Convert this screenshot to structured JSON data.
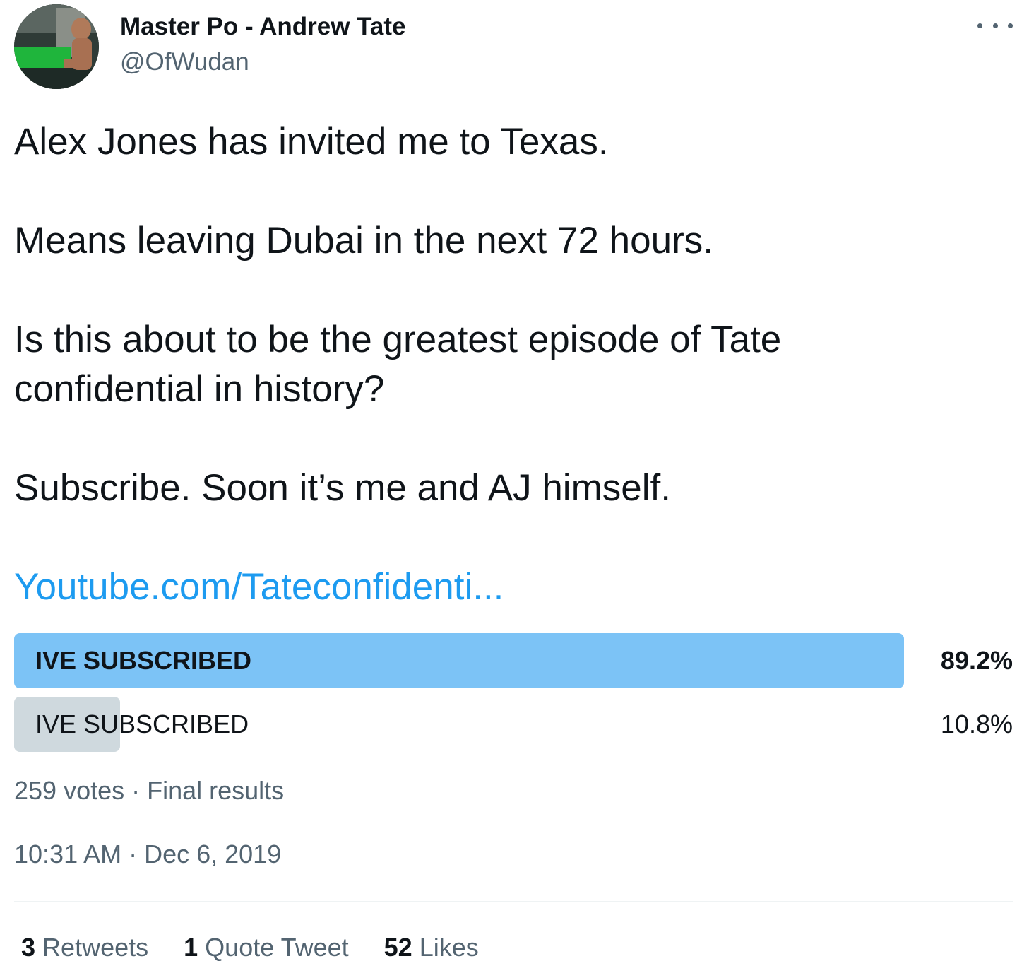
{
  "author": {
    "display_name": "Master Po - Andrew Tate",
    "handle": "@OfWudan"
  },
  "tweet": {
    "lines": [
      "Alex Jones has invited me to Texas.",
      "Means leaving Dubai in the next 72 hours.",
      "Is this about to be the greatest episode of Tate",
      "confidential in history?",
      "Subscribe. Soon it’s me and AJ himself."
    ],
    "link": "Youtube.com/Tateconfidenti..."
  },
  "poll": {
    "options": [
      {
        "label": "IVE SUBSCRIBED",
        "percent_text": "89.2%",
        "percent": 89.2,
        "winner": true
      },
      {
        "label": "IVE SUBSCRIBED",
        "percent_text": "10.8%",
        "percent": 10.8,
        "winner": false
      }
    ],
    "summary": "259 votes · Final results"
  },
  "timestamp": "10:31 AM · Dec 6, 2019",
  "stats": {
    "retweets": {
      "count": "3",
      "label": "Retweets"
    },
    "quotes": {
      "count": "1",
      "label": "Quote Tweet"
    },
    "likes": {
      "count": "52",
      "label": "Likes"
    }
  },
  "colors": {
    "link": "#1d9bf0",
    "poll_winner": "#7cc3f6",
    "poll_other": "#cfd9de",
    "secondary_text": "#536471"
  },
  "icons": {
    "more": "more-horizontal-icon"
  }
}
